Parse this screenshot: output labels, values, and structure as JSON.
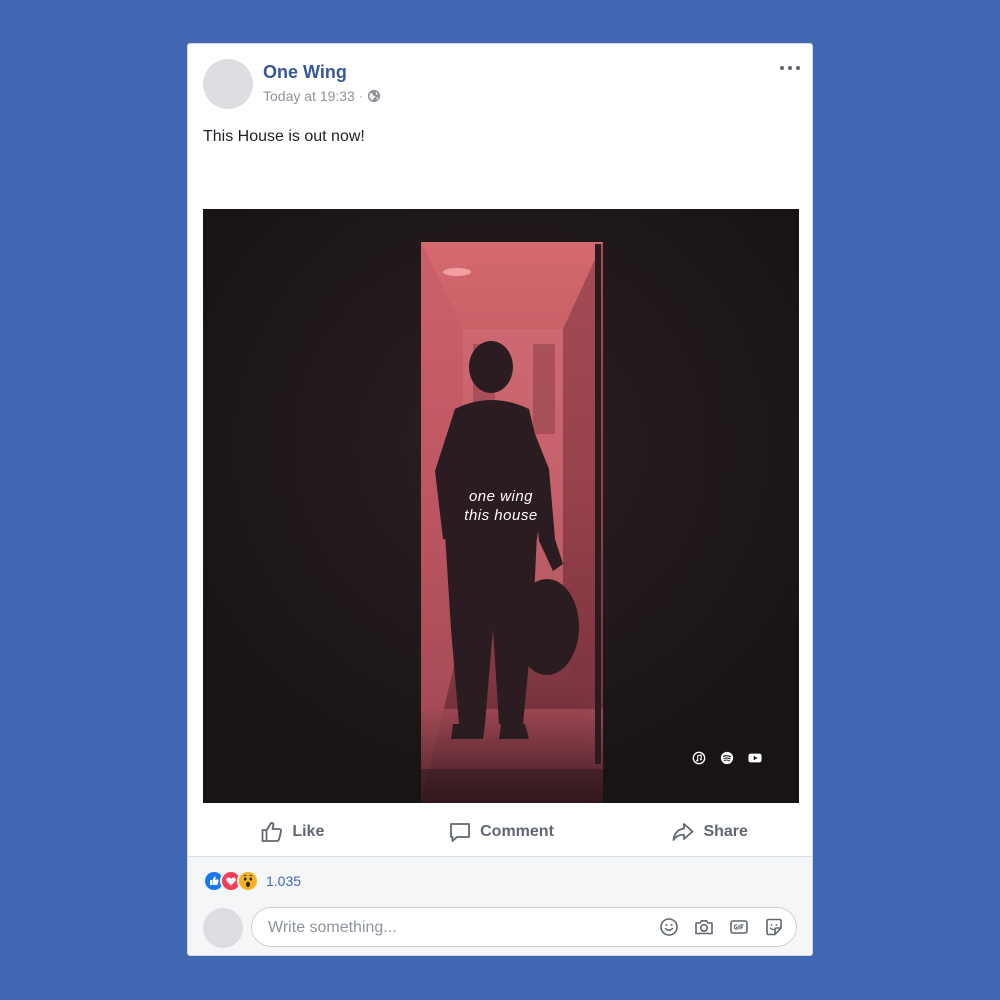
{
  "post": {
    "author": "One Wing",
    "timestamp": "Today at 19:33",
    "separator": "·",
    "privacy_icon": "globe-icon",
    "text": "This House is out now!"
  },
  "image": {
    "overlay_line1": "one wing",
    "overlay_line2": "this house",
    "platform_icons": [
      "itunes-icon",
      "spotify-icon",
      "youtube-icon"
    ]
  },
  "actions": {
    "like_label": "Like",
    "comment_label": "Comment",
    "share_label": "Share"
  },
  "reactions": {
    "types": [
      "like",
      "love",
      "wow"
    ],
    "count": "1.035"
  },
  "comment": {
    "placeholder": "Write something...",
    "tools": [
      "emoji-icon",
      "camera-icon",
      "gif-icon",
      "sticker-icon"
    ]
  },
  "colors": {
    "background": "#4267b2",
    "author_link": "#365899",
    "like_blue": "#1877f2",
    "love_red": "#f33e58",
    "wow_yellow": "#f7b125"
  }
}
